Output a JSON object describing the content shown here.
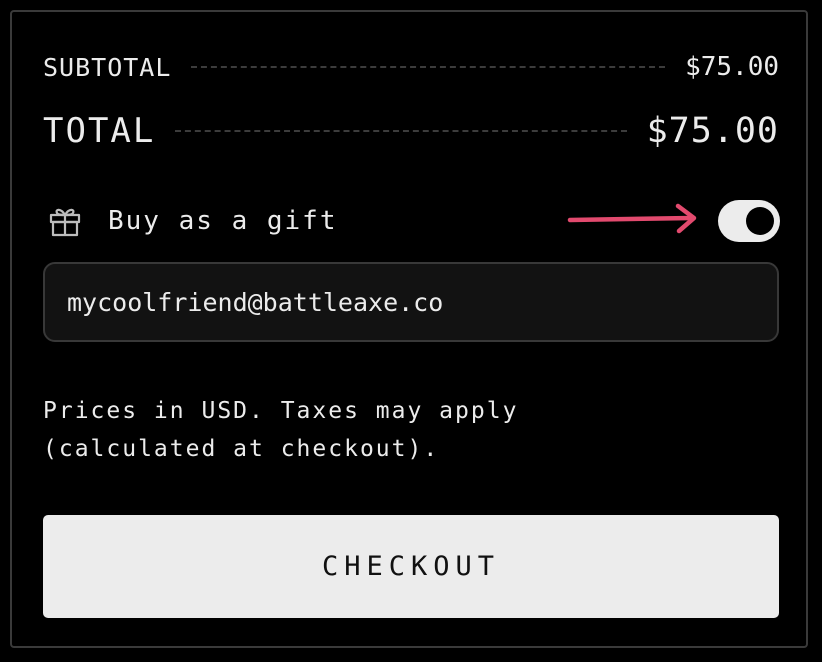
{
  "summary": {
    "subtotal_label": "SUBTOTAL",
    "subtotal_value": "$75.00",
    "total_label": "TOTAL",
    "total_value": "$75.00"
  },
  "gift": {
    "icon": "gift-icon",
    "label": "Buy as a gift",
    "toggle_on": true,
    "arrow_color": "#e24a6e"
  },
  "email": {
    "value": "mycoolfriend@battleaxe.co"
  },
  "note": {
    "line1": "Prices in USD. Taxes may apply",
    "line2": "(calculated at checkout)."
  },
  "checkout": {
    "label": "CHECKOUT"
  },
  "colors": {
    "background": "#000000",
    "text": "#ececec",
    "accent_arrow": "#e24a6e",
    "button": "#ececec"
  }
}
